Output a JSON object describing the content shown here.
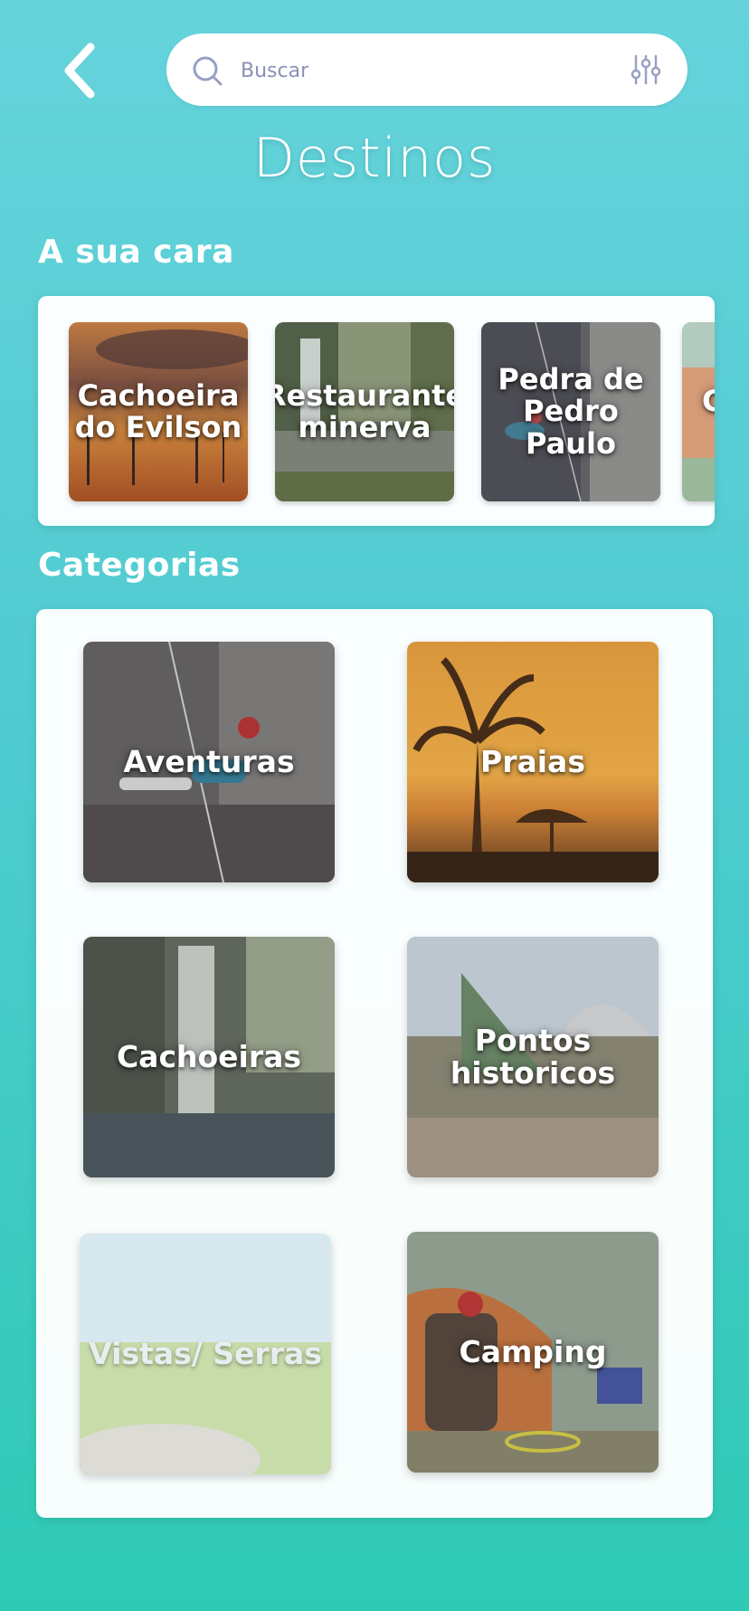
{
  "header": {
    "back_icon": "chevron-left-icon",
    "search": {
      "placeholder": "Buscar",
      "value": "",
      "search_icon": "search-icon",
      "filter_icon": "sliders-icon"
    },
    "title": "Destinos"
  },
  "recommendations": {
    "title": "A sua cara",
    "items": [
      {
        "label": "Cachoeira do Evilson"
      },
      {
        "label": "Restaurante minerva"
      },
      {
        "label": "Pedra de Pedro Paulo"
      },
      {
        "label": "C"
      }
    ]
  },
  "categories": {
    "title": "Categorias",
    "items": [
      {
        "label": "Aventuras"
      },
      {
        "label": "Praias"
      },
      {
        "label": "Cachoeiras"
      },
      {
        "label": "Pontos historicos"
      },
      {
        "label": "Vistas/ Serras"
      },
      {
        "label": "Camping"
      }
    ]
  },
  "colors": {
    "accent_top": "#66d3db",
    "accent_bottom": "#2fcab5",
    "search_text": "#3e4a8a"
  }
}
